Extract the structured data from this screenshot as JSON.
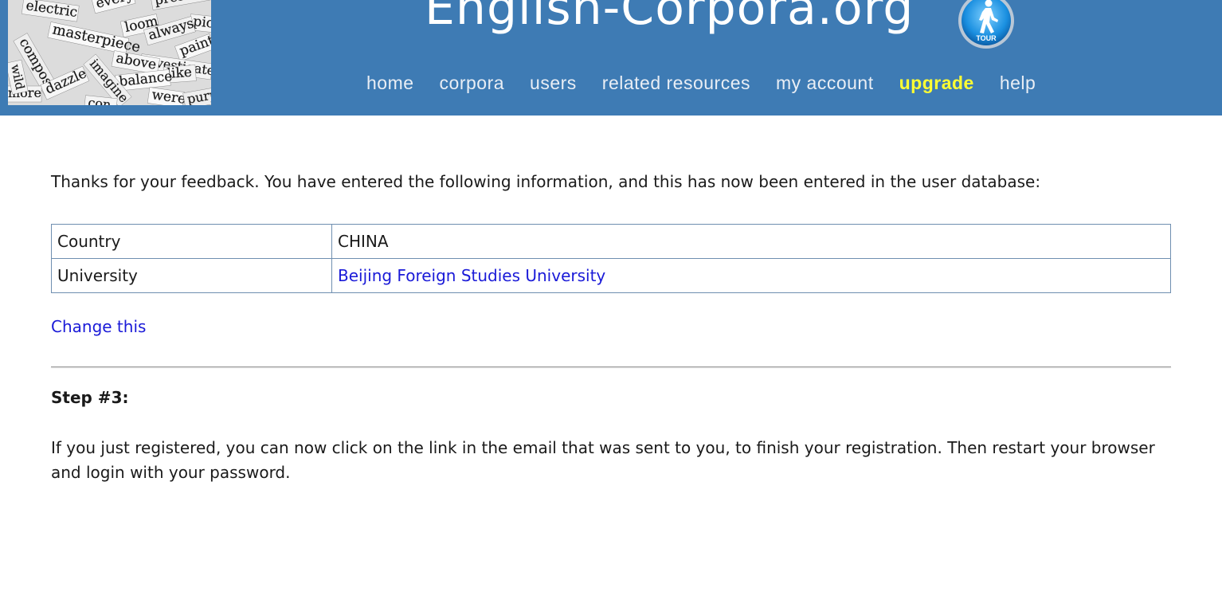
{
  "header": {
    "site_title": "English-Corpora.org",
    "tour_label": "TOUR",
    "logo_words": [
      "electric",
      "every",
      "pressio",
      "pic",
      "loom",
      "masterpiece",
      "always",
      "paint",
      "compose",
      "investigate",
      "above",
      "like",
      "balance",
      "imagine",
      "dazzle",
      "more",
      "were",
      "purp",
      "con",
      "wild"
    ],
    "nav": [
      {
        "label": "home"
      },
      {
        "label": "corpora"
      },
      {
        "label": "users"
      },
      {
        "label": "related resources"
      },
      {
        "label": "my account"
      },
      {
        "label": "upgrade"
      },
      {
        "label": "help"
      }
    ]
  },
  "main": {
    "intro": "Thanks for your feedback. You have entered the following information, and this has now been entered in the user database:",
    "table": {
      "rows": [
        {
          "label": "Country",
          "value": "CHINA"
        },
        {
          "label": "University",
          "value": "Beijing Foreign Studies University"
        }
      ]
    },
    "change_link": "Change this",
    "step_heading": "Step #3:",
    "step_text": "If you just registered, you can now click on the link in the email that was sent to you, to finish your registration. Then restart your browser and login with your password."
  },
  "colors": {
    "header_bg": "#3e7bb4",
    "nav_text": "#e9eef5",
    "upgrade": "#ffff33",
    "link": "#1a1ad8",
    "table_border": "#6f8fb0"
  }
}
